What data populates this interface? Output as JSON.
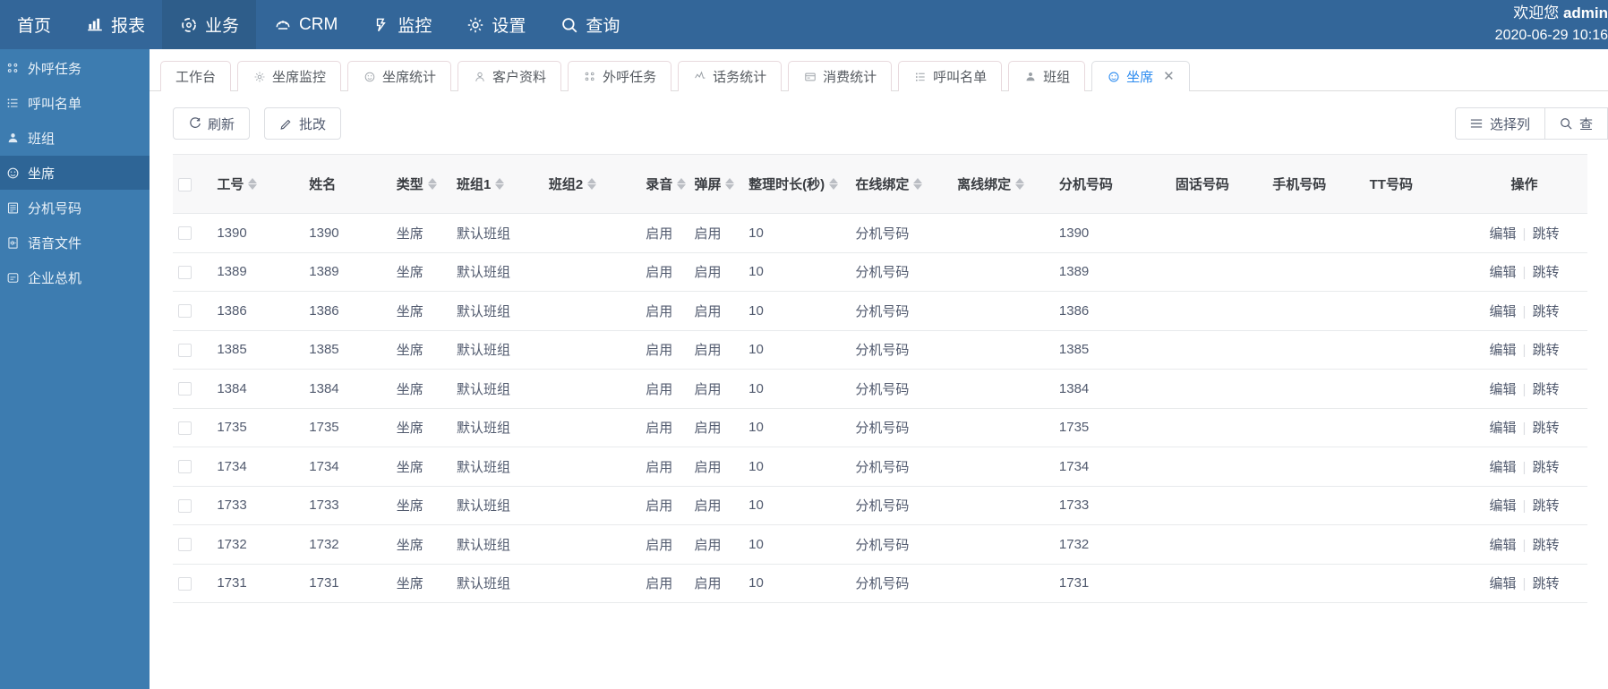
{
  "topnav": {
    "items": [
      {
        "label": "首页",
        "icon": "home-icon",
        "active": false,
        "has_icon": false
      },
      {
        "label": "报表",
        "icon": "chart-icon",
        "active": false,
        "has_icon": true
      },
      {
        "label": "业务",
        "icon": "business-icon",
        "active": true,
        "has_icon": true
      },
      {
        "label": "CRM",
        "icon": "crm-icon",
        "active": false,
        "has_icon": true
      },
      {
        "label": "监控",
        "icon": "monitor-icon",
        "active": false,
        "has_icon": true
      },
      {
        "label": "设置",
        "icon": "gear-icon",
        "active": false,
        "has_icon": true
      },
      {
        "label": "查询",
        "icon": "search-icon",
        "active": false,
        "has_icon": true
      }
    ],
    "welcome_prefix": "欢迎您 ",
    "welcome_user": "admin",
    "datetime": "2020-06-29 10:16"
  },
  "sidebar": {
    "items": [
      {
        "label": "外呼任务",
        "icon": "tasks-icon",
        "active": false
      },
      {
        "label": "呼叫名单",
        "icon": "list-icon",
        "active": false
      },
      {
        "label": "班组",
        "icon": "group-icon",
        "active": false
      },
      {
        "label": "坐席",
        "icon": "seat-icon",
        "active": true
      },
      {
        "label": "分机号码",
        "icon": "extension-icon",
        "active": false
      },
      {
        "label": "语音文件",
        "icon": "voice-file-icon",
        "active": false
      },
      {
        "label": "企业总机",
        "icon": "switchboard-icon",
        "active": false
      }
    ]
  },
  "tabs": [
    {
      "label": "工作台",
      "icon": null,
      "active": false,
      "closable": false
    },
    {
      "label": "坐席监控",
      "icon": "monitor-seat-icon",
      "active": false,
      "closable": false
    },
    {
      "label": "坐席统计",
      "icon": "seat-stats-icon",
      "active": false,
      "closable": false
    },
    {
      "label": "客户资料",
      "icon": "customer-icon",
      "active": false,
      "closable": false
    },
    {
      "label": "外呼任务",
      "icon": "tasks-icon",
      "active": false,
      "closable": false
    },
    {
      "label": "话务统计",
      "icon": "traffic-stats-icon",
      "active": false,
      "closable": false
    },
    {
      "label": "消费统计",
      "icon": "consume-stats-icon",
      "active": false,
      "closable": false
    },
    {
      "label": "呼叫名单",
      "icon": "call-list-icon",
      "active": false,
      "closable": false
    },
    {
      "label": "班组",
      "icon": "group-icon",
      "active": false,
      "closable": false
    },
    {
      "label": "坐席",
      "icon": "seat-icon",
      "active": true,
      "closable": true
    }
  ],
  "toolbar": {
    "refresh_label": "刷新",
    "refresh_icon": "refresh-icon",
    "batch_edit_label": "批改",
    "batch_edit_icon": "pencil-icon",
    "columns_label": "选择列",
    "columns_icon": "menu-icon",
    "search_label": "查",
    "search_icon": "search-icon"
  },
  "table": {
    "columns": [
      {
        "key": "checkbox",
        "label": "",
        "sortable": false
      },
      {
        "key": "work_no",
        "label": "工号",
        "sortable": true
      },
      {
        "key": "name",
        "label": "姓名",
        "sortable": false
      },
      {
        "key": "type",
        "label": "类型",
        "sortable": true
      },
      {
        "key": "group1",
        "label": "班组1",
        "sortable": true
      },
      {
        "key": "group2",
        "label": "班组2",
        "sortable": true
      },
      {
        "key": "record",
        "label": "录音",
        "sortable": true
      },
      {
        "key": "popup",
        "label": "弹屏",
        "sortable": true
      },
      {
        "key": "wrapup",
        "label": "整理时长(秒)",
        "sortable": true
      },
      {
        "key": "online_bind",
        "label": "在线绑定",
        "sortable": true
      },
      {
        "key": "offline_bind",
        "label": "离线绑定",
        "sortable": true
      },
      {
        "key": "extension",
        "label": "分机号码",
        "sortable": false
      },
      {
        "key": "landline",
        "label": "固话号码",
        "sortable": false
      },
      {
        "key": "mobile",
        "label": "手机号码",
        "sortable": false
      },
      {
        "key": "tt_no",
        "label": "TT号码",
        "sortable": false
      },
      {
        "key": "ops",
        "label": "操作",
        "sortable": false
      }
    ],
    "op_edit": "编辑",
    "op_jump": "跳转",
    "rows": [
      {
        "work_no": "1390",
        "name": "1390",
        "type": "坐席",
        "group1": "默认班组",
        "group2": "",
        "record": "启用",
        "popup": "启用",
        "wrapup": "10",
        "online_bind": "分机号码",
        "offline_bind": "",
        "extension": "1390",
        "landline": "",
        "mobile": "",
        "tt_no": ""
      },
      {
        "work_no": "1389",
        "name": "1389",
        "type": "坐席",
        "group1": "默认班组",
        "group2": "",
        "record": "启用",
        "popup": "启用",
        "wrapup": "10",
        "online_bind": "分机号码",
        "offline_bind": "",
        "extension": "1389",
        "landline": "",
        "mobile": "",
        "tt_no": ""
      },
      {
        "work_no": "1386",
        "name": "1386",
        "type": "坐席",
        "group1": "默认班组",
        "group2": "",
        "record": "启用",
        "popup": "启用",
        "wrapup": "10",
        "online_bind": "分机号码",
        "offline_bind": "",
        "extension": "1386",
        "landline": "",
        "mobile": "",
        "tt_no": ""
      },
      {
        "work_no": "1385",
        "name": "1385",
        "type": "坐席",
        "group1": "默认班组",
        "group2": "",
        "record": "启用",
        "popup": "启用",
        "wrapup": "10",
        "online_bind": "分机号码",
        "offline_bind": "",
        "extension": "1385",
        "landline": "",
        "mobile": "",
        "tt_no": ""
      },
      {
        "work_no": "1384",
        "name": "1384",
        "type": "坐席",
        "group1": "默认班组",
        "group2": "",
        "record": "启用",
        "popup": "启用",
        "wrapup": "10",
        "online_bind": "分机号码",
        "offline_bind": "",
        "extension": "1384",
        "landline": "",
        "mobile": "",
        "tt_no": ""
      },
      {
        "work_no": "1735",
        "name": "1735",
        "type": "坐席",
        "group1": "默认班组",
        "group2": "",
        "record": "启用",
        "popup": "启用",
        "wrapup": "10",
        "online_bind": "分机号码",
        "offline_bind": "",
        "extension": "1735",
        "landline": "",
        "mobile": "",
        "tt_no": ""
      },
      {
        "work_no": "1734",
        "name": "1734",
        "type": "坐席",
        "group1": "默认班组",
        "group2": "",
        "record": "启用",
        "popup": "启用",
        "wrapup": "10",
        "online_bind": "分机号码",
        "offline_bind": "",
        "extension": "1734",
        "landline": "",
        "mobile": "",
        "tt_no": ""
      },
      {
        "work_no": "1733",
        "name": "1733",
        "type": "坐席",
        "group1": "默认班组",
        "group2": "",
        "record": "启用",
        "popup": "启用",
        "wrapup": "10",
        "online_bind": "分机号码",
        "offline_bind": "",
        "extension": "1733",
        "landline": "",
        "mobile": "",
        "tt_no": ""
      },
      {
        "work_no": "1732",
        "name": "1732",
        "type": "坐席",
        "group1": "默认班组",
        "group2": "",
        "record": "启用",
        "popup": "启用",
        "wrapup": "10",
        "online_bind": "分机号码",
        "offline_bind": "",
        "extension": "1732",
        "landline": "",
        "mobile": "",
        "tt_no": ""
      },
      {
        "work_no": "1731",
        "name": "1731",
        "type": "坐席",
        "group1": "默认班组",
        "group2": "",
        "record": "启用",
        "popup": "启用",
        "wrapup": "10",
        "online_bind": "分机号码",
        "offline_bind": "",
        "extension": "1731",
        "landline": "",
        "mobile": "",
        "tt_no": ""
      }
    ]
  },
  "colors": {
    "nav_bg": "#336699",
    "nav_active": "#2e5d8a",
    "sidebar_bg": "#3d7cb0",
    "sidebar_active": "#2e6596",
    "link": "#2d8cf0",
    "header_bg": "#f8f8f9",
    "border": "#e8eaec"
  }
}
